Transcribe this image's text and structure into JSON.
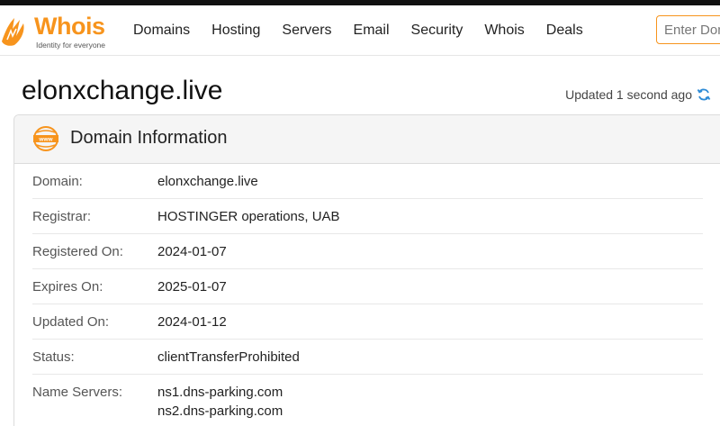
{
  "brand": {
    "name": "Whois",
    "tagline": "Identity for everyone",
    "accent_color": "#f7941d"
  },
  "nav": {
    "items": [
      "Domains",
      "Hosting",
      "Servers",
      "Email",
      "Security",
      "Whois",
      "Deals"
    ]
  },
  "search": {
    "placeholder": "Enter Domain"
  },
  "page": {
    "title": "elonxchange.live",
    "updated_text": "Updated 1 second ago"
  },
  "domain_info": {
    "title": "Domain Information",
    "rows": [
      {
        "label": "Domain:",
        "values": [
          "elonxchange.live"
        ]
      },
      {
        "label": "Registrar:",
        "values": [
          "HOSTINGER operations, UAB"
        ]
      },
      {
        "label": "Registered On:",
        "values": [
          "2024-01-07"
        ]
      },
      {
        "label": "Expires On:",
        "values": [
          "2025-01-07"
        ]
      },
      {
        "label": "Updated On:",
        "values": [
          "2024-01-12"
        ]
      },
      {
        "label": "Status:",
        "values": [
          "clientTransferProhibited"
        ]
      },
      {
        "label": "Name Servers:",
        "values": [
          "ns1.dns-parking.com",
          "ns2.dns-parking.com"
        ]
      }
    ]
  }
}
